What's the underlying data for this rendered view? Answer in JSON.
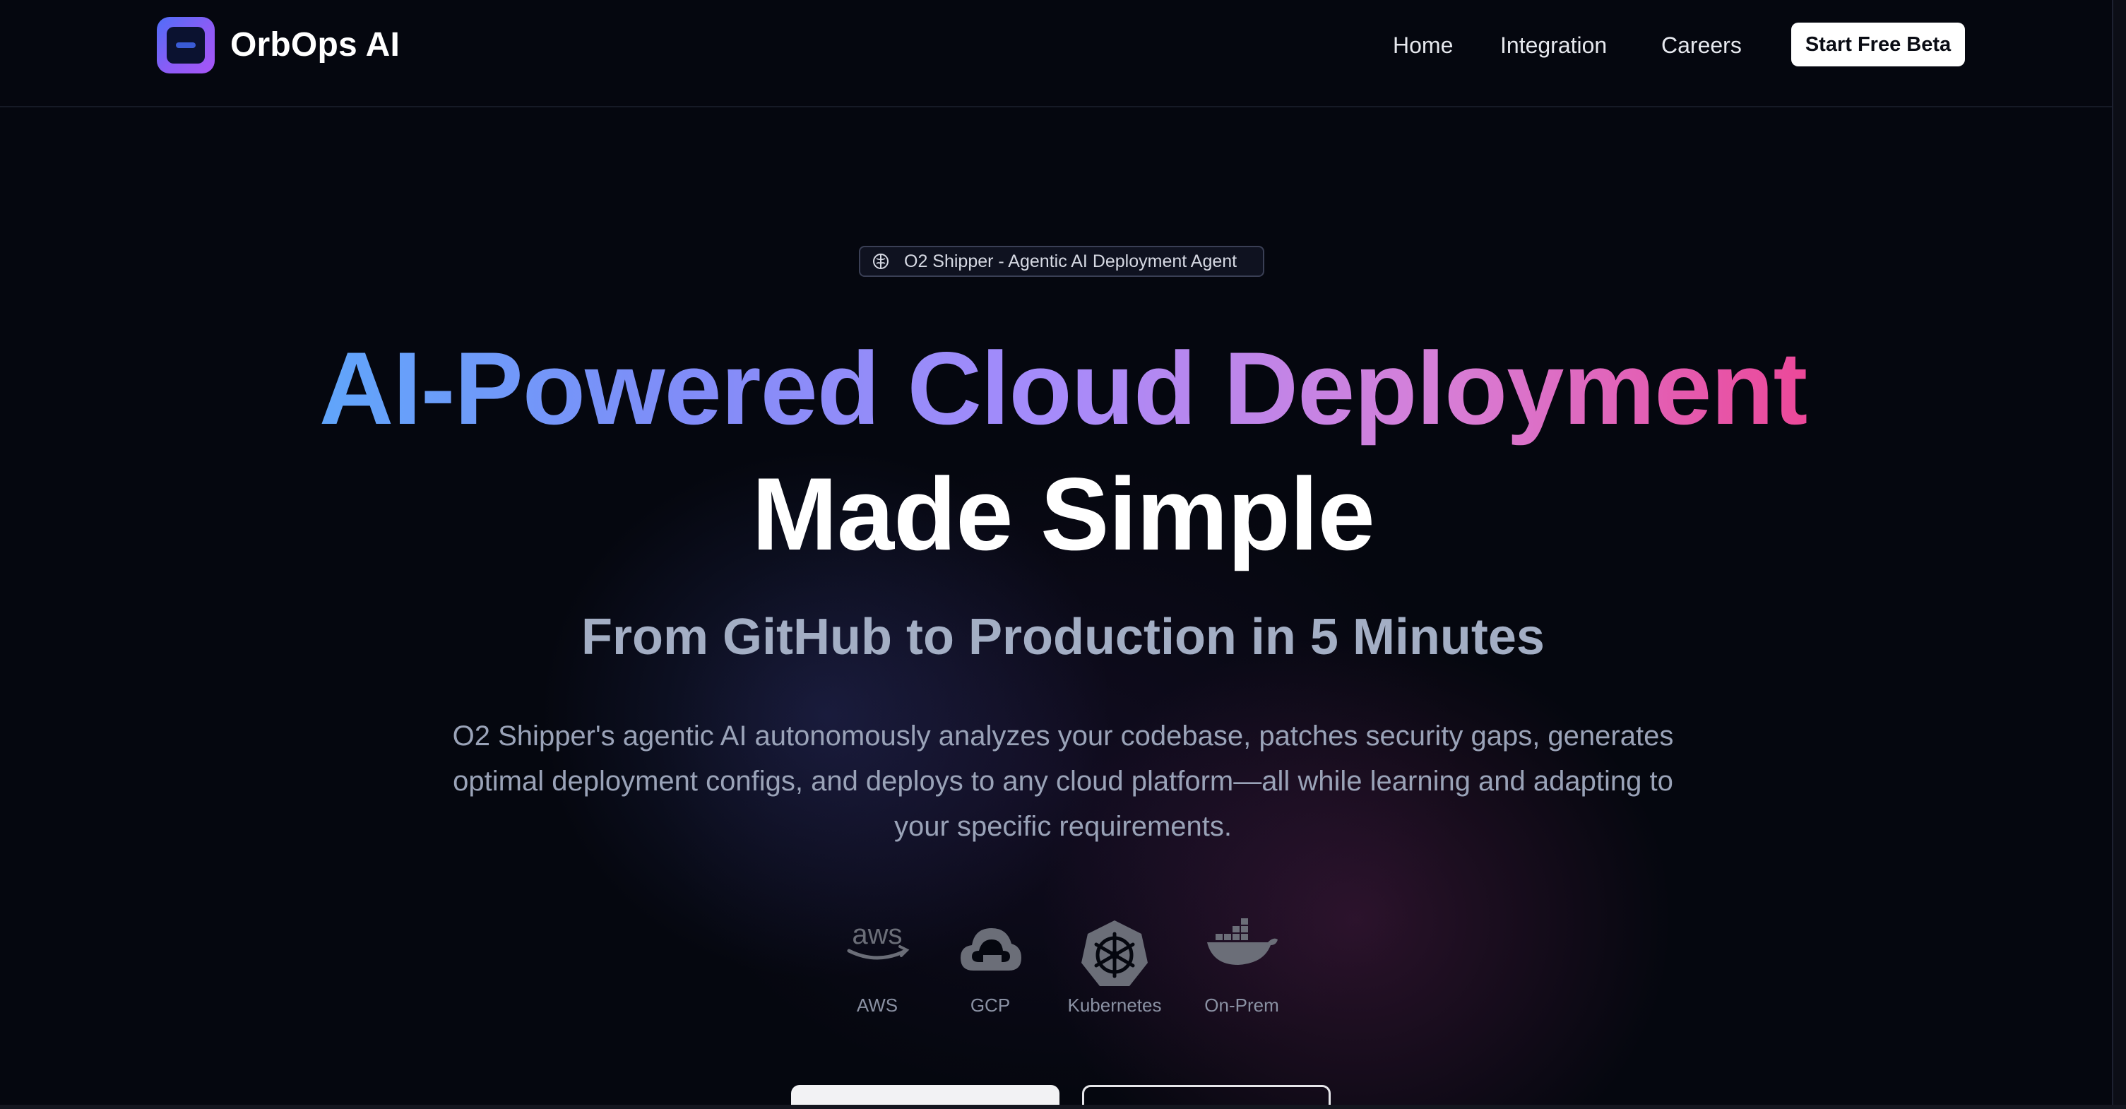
{
  "header": {
    "brand": "OrbOps AI",
    "nav": [
      {
        "label": "Home"
      },
      {
        "label": "Integration"
      },
      {
        "label": "Careers"
      }
    ],
    "cta_label": "Start Free Beta"
  },
  "hero": {
    "badge_text": "O2 Shipper - Agentic AI Deployment Agent",
    "headline_gradient": "AI-Powered Cloud Deployment",
    "headline_plain": "Made Simple",
    "subheadline": "From GitHub to Production in 5 Minutes",
    "description": "O2 Shipper's agentic AI autonomously analyzes your codebase, patches security gaps, generates optimal deployment configs, and deploys to any cloud platform—all while learning and adapting to your specific requirements.",
    "gradient_colors": [
      "#60a5fa",
      "#818cf8",
      "#a78bfa",
      "#d67fd8",
      "#ec4899"
    ]
  },
  "platforms": [
    {
      "label": "AWS",
      "icon": "aws-icon"
    },
    {
      "label": "GCP",
      "icon": "gcp-cloud-icon"
    },
    {
      "label": "Kubernetes",
      "icon": "kubernetes-icon"
    },
    {
      "label": "On-Prem",
      "icon": "docker-whale-icon"
    }
  ],
  "colors": {
    "background": "#05070f",
    "logo_gradient_start": "#4f6ef7",
    "logo_gradient_end": "#a855f7",
    "subheadline": "#a3aec4",
    "body_text": "#9aa3b8",
    "icon_gray": "#6b6e78"
  }
}
